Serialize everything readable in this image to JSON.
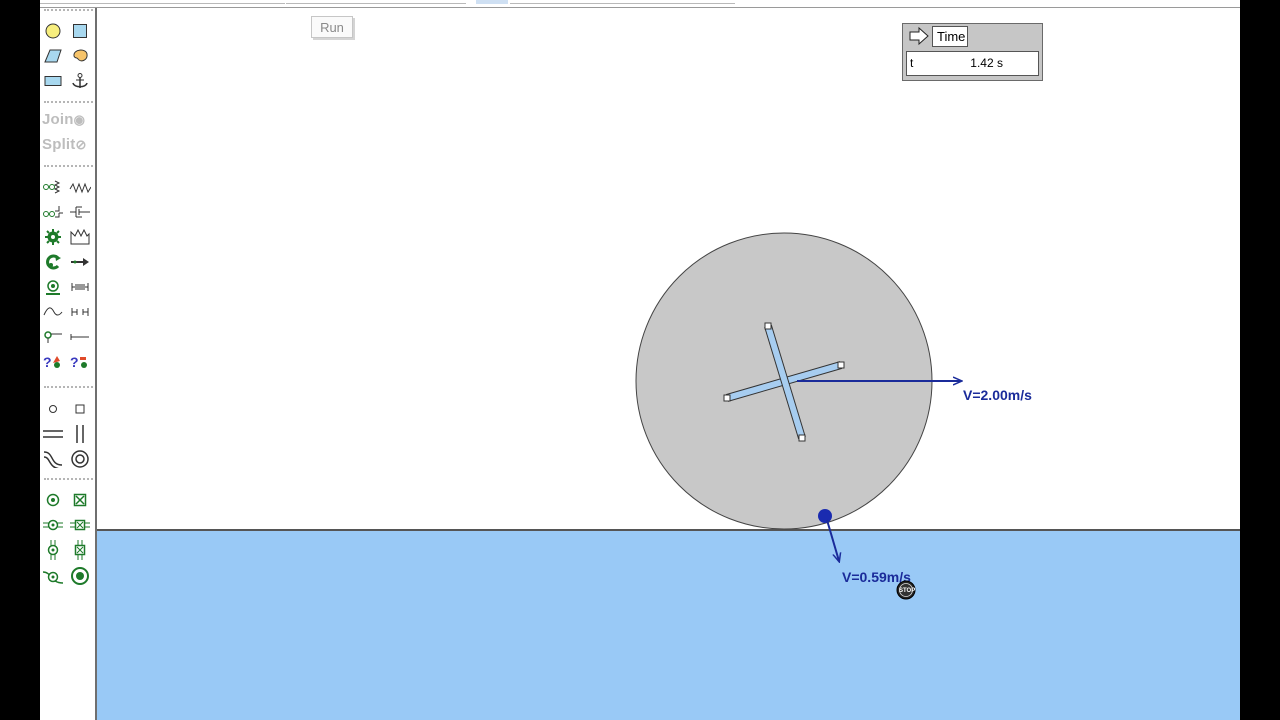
{
  "toolbar": {
    "join_label": "Join",
    "split_label": "Split",
    "icons": [
      "circle-tool-icon",
      "square-tool-icon",
      "polygon-tool-icon",
      "curved-body-tool-icon",
      "rectangle-tool-icon",
      "anchor-icon",
      "spring-tool-icon",
      "spring-joint-icon",
      "damper-tool-icon",
      "damper-joint-icon",
      "motor-icon",
      "actuator-icon",
      "torque-icon",
      "force-icon",
      "rotational-spring-icon",
      "rope-icon",
      "curve-icon",
      "separator-icon",
      "hook-icon",
      "line-icon",
      "help-icon-1",
      "help-icon-2",
      "point-icon",
      "square-point-icon",
      "horizontal-slot-icon",
      "vertical-slot-icon",
      "curved-slot-icon",
      "keyed-slot-icon",
      "pin-joint-icon",
      "rigid-joint-icon",
      "horizontal-pin-slot-icon",
      "horizontal-rigid-slot-icon",
      "vertical-pin-slot-icon",
      "vertical-rigid-slot-icon",
      "curved-pin-slot-icon",
      "keyed-slot-joint-icon"
    ]
  },
  "run_button": {
    "label": "Run"
  },
  "time_meter": {
    "title": "Time",
    "variable": "t",
    "value": "1.42 s"
  },
  "scene": {
    "wheel_velocity_label": "V=2.00m/s",
    "contact_velocity_label": "V=0.59m/s",
    "stop_label": "STOP",
    "colors": {
      "water": "#99c9f6",
      "wheel": "#c8c8c8",
      "vector": "#1a2b9a",
      "rod": "#a7cdf0"
    }
  }
}
